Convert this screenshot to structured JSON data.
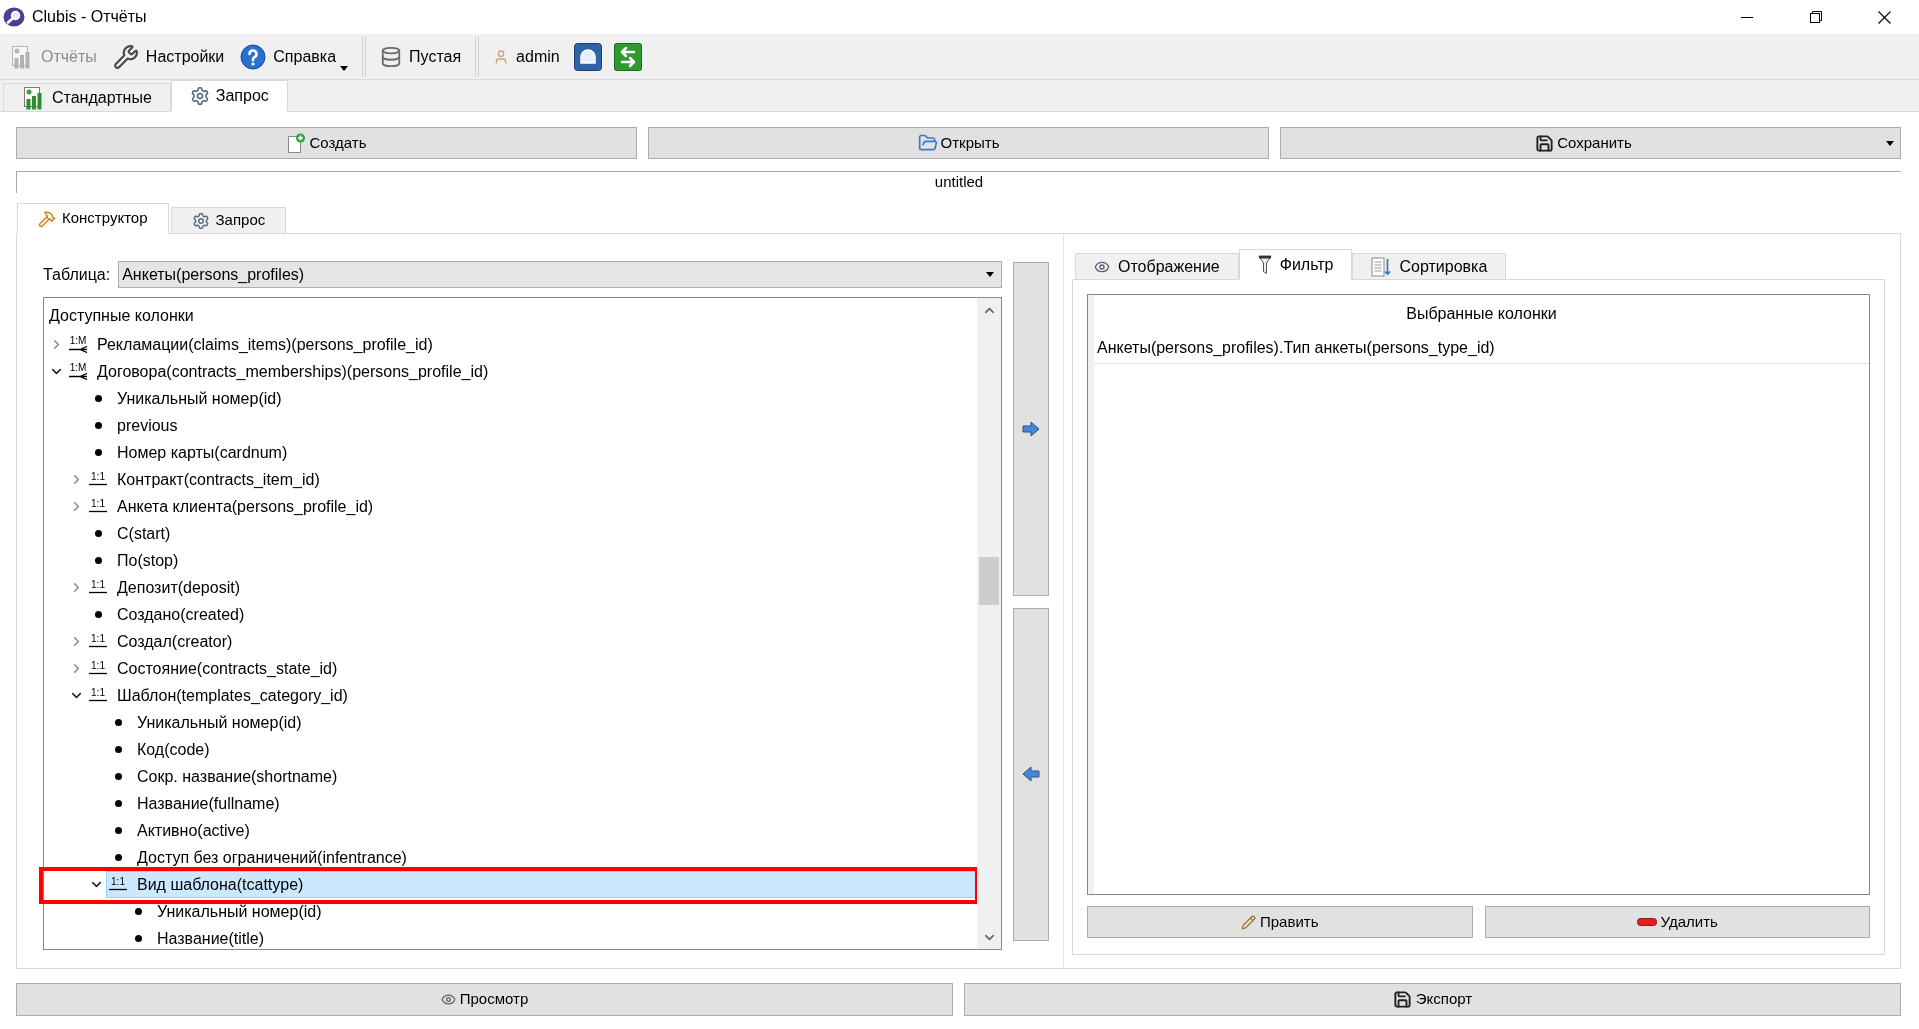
{
  "window": {
    "title": "Clubis - Отчёты"
  },
  "toolbar": [
    {
      "kind": "button",
      "label": "Отчёты",
      "disabled": true
    },
    {
      "kind": "button",
      "label": "Настройки",
      "disabled": false
    },
    {
      "kind": "menu",
      "label": "Справка",
      "disabled": false
    },
    {
      "kind": "separator"
    },
    {
      "kind": "button",
      "label": "Пустая",
      "disabled": false
    },
    {
      "kind": "separator"
    },
    {
      "kind": "button",
      "label": "admin",
      "disabled": false
    },
    {
      "kind": "icon_button",
      "disabled": false
    },
    {
      "kind": "icon_button",
      "disabled": false
    }
  ],
  "tabs": [
    {
      "label": "Стандартные",
      "selected": false
    },
    {
      "label": "Запрос",
      "selected": true
    }
  ],
  "actions": [
    {
      "label": "Создать",
      "menu": false
    },
    {
      "label": "Открыть",
      "menu": false
    },
    {
      "label": "Сохранить",
      "menu": true
    }
  ],
  "report_name": {
    "value": "untitled"
  },
  "editor_tabs": [
    {
      "label": "Конструктор",
      "selected": true
    },
    {
      "label": "Запрос",
      "selected": false
    }
  ],
  "designer": {
    "table": {
      "label": "Таблица:",
      "value": "Анкеты(persons_profiles)"
    },
    "tree": {
      "header": "Доступные колонки",
      "items": [
        {
          "kind": "one_to_many",
          "badge": "1:M",
          "label": "Рекламации(claims_items)(persons_profile_id)",
          "expanded": false,
          "selected": false,
          "highlighted": false
        },
        {
          "kind": "one_to_many",
          "badge": "1:M",
          "label": "Договора(contracts_memberships)(persons_profile_id)",
          "expanded": true,
          "selected": false,
          "highlighted": false,
          "children": [
            {
              "kind": "field",
              "label": "Уникальный номер(id)",
              "selected": false,
              "highlighted": false
            },
            {
              "kind": "field",
              "label": "previous",
              "selected": false,
              "highlighted": false
            },
            {
              "kind": "field",
              "label": "Номер карты(cardnum)",
              "selected": false,
              "highlighted": false
            },
            {
              "kind": "one_to_one",
              "badge": "1:1",
              "label": "Контракт(contracts_item_id)",
              "expanded": false,
              "selected": false,
              "highlighted": false
            },
            {
              "kind": "one_to_one",
              "badge": "1:1",
              "label": "Анкета клиента(persons_profile_id)",
              "expanded": false,
              "selected": false,
              "highlighted": false
            },
            {
              "kind": "field",
              "label": "С(start)",
              "selected": false,
              "highlighted": false
            },
            {
              "kind": "field",
              "label": "По(stop)",
              "selected": false,
              "highlighted": false
            },
            {
              "kind": "one_to_one",
              "badge": "1:1",
              "label": "Депозит(deposit)",
              "expanded": false,
              "selected": false,
              "highlighted": false
            },
            {
              "kind": "field",
              "label": "Создано(created)",
              "selected": false,
              "highlighted": false
            },
            {
              "kind": "one_to_one",
              "badge": "1:1",
              "label": "Создал(creator)",
              "expanded": false,
              "selected": false,
              "highlighted": false
            },
            {
              "kind": "one_to_one",
              "badge": "1:1",
              "label": "Состояние(contracts_state_id)",
              "expanded": false,
              "selected": false,
              "highlighted": false
            },
            {
              "kind": "one_to_one",
              "badge": "1:1",
              "label": "Шаблон(templates_category_id)",
              "expanded": true,
              "selected": false,
              "highlighted": false,
              "children": [
                {
                  "kind": "field",
                  "label": "Уникальный номер(id)",
                  "selected": false,
                  "highlighted": false
                },
                {
                  "kind": "field",
                  "label": "Код(code)",
                  "selected": false,
                  "highlighted": false
                },
                {
                  "kind": "field",
                  "label": "Сокр. название(shortname)",
                  "selected": false,
                  "highlighted": false
                },
                {
                  "kind": "field",
                  "label": "Название(fullname)",
                  "selected": false,
                  "highlighted": false
                },
                {
                  "kind": "field",
                  "label": "Активно(active)",
                  "selected": false,
                  "highlighted": false
                },
                {
                  "kind": "field",
                  "label": "Доступ без ограничений(infentrance)",
                  "selected": false,
                  "highlighted": false
                },
                {
                  "kind": "one_to_one",
                  "badge": "1:1",
                  "label": "Вид шаблона(tcattype)",
                  "expanded": true,
                  "selected": true,
                  "highlighted": true,
                  "children": [
                    {
                      "kind": "field",
                      "label": "Уникальный номер(id)",
                      "selected": false,
                      "highlighted": false
                    },
                    {
                      "kind": "field",
                      "label": "Название(title)",
                      "selected": false,
                      "highlighted": false
                    }
                  ]
                }
              ]
            }
          ]
        }
      ]
    }
  },
  "filter_panel": {
    "tabs": [
      {
        "label": "Отображение",
        "selected": false
      },
      {
        "label": "Фильтр",
        "selected": true
      },
      {
        "label": "Сортировка",
        "selected": false
      }
    ],
    "list": {
      "header": "Выбранные колонки",
      "rows": [
        {
          "label": "Анкеты(persons_profiles).Тип анкеты(persons_type_id)",
          "selected": false
        }
      ]
    },
    "buttons": [
      {
        "label": "Править"
      },
      {
        "label": "Удалить"
      }
    ]
  },
  "footer_buttons": [
    {
      "label": "Просмотр"
    },
    {
      "label": "Экспорт"
    }
  ]
}
